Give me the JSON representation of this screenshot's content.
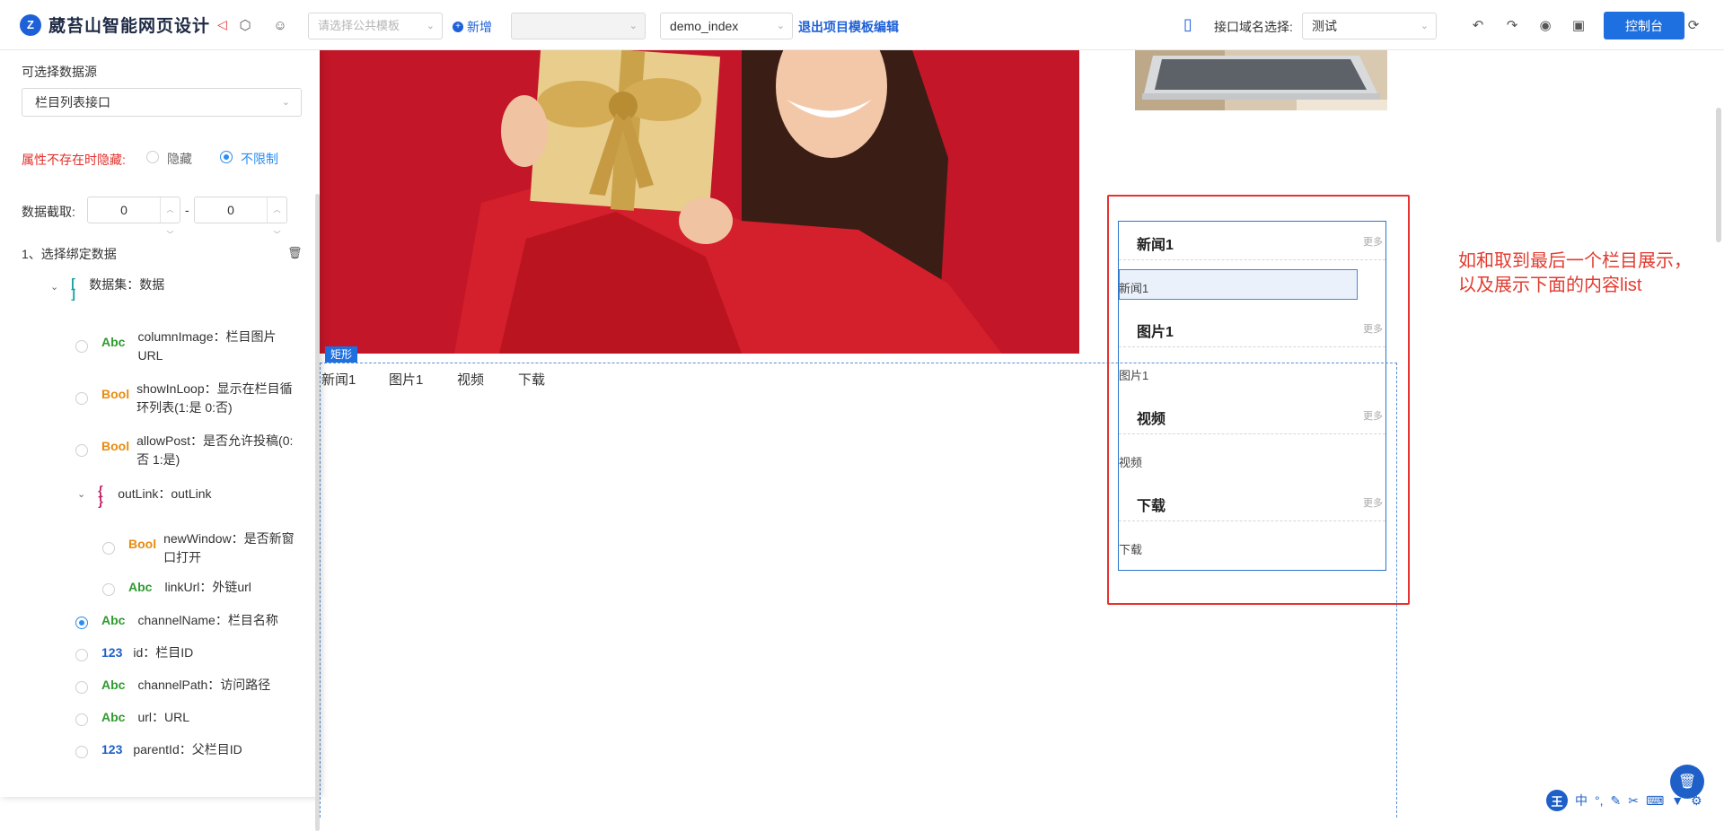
{
  "app": {
    "logo_mark": "Z",
    "title": "葳苔山智能网页设计"
  },
  "toolbar": {
    "template_placeholder": "请选择公共模板",
    "add_label": "新增",
    "page_select": "demo_index",
    "exit_link": "退出项目模板编辑",
    "domain_label": "接口域名选择:",
    "domain_value": "测试",
    "console_button": "控制台"
  },
  "left_panel": {
    "datasource_label": "可选择数据源",
    "datasource_value": "栏目列表接口",
    "hide_label": "属性不存在时隐藏:",
    "hide_option": "隐藏",
    "nolimit_option": "不限制",
    "slice_label": "数据截取:",
    "slice_from": "0",
    "slice_dash": "-",
    "slice_to": "0",
    "bind_title": "1、选择绑定数据",
    "dataset_label": "数据集：数据",
    "fields": [
      {
        "type": "Abc",
        "text": "columnImage：栏目图片URL"
      },
      {
        "type": "Bool",
        "text": "showInLoop：显示在栏目循环列表(1:是 0:否)"
      },
      {
        "type": "Bool",
        "text": "allowPost：是否允许投稿(0:否 1:是)"
      },
      {
        "type": "{ }",
        "text": "outLink：outLink"
      },
      {
        "type": "Bool",
        "text": "newWindow：是否新窗口打开"
      },
      {
        "type": "Abc",
        "text": "linkUrl：外链url"
      },
      {
        "type": "Abc",
        "text": "channelName：栏目名称"
      },
      {
        "type": "123",
        "text": "id：栏目ID"
      },
      {
        "type": "Abc",
        "text": "channelPath：访问路径"
      },
      {
        "type": "Abc",
        "text": "url：URL"
      },
      {
        "type": "123",
        "text": "parentId：父栏目ID"
      }
    ]
  },
  "canvas": {
    "rect_label": "矩形",
    "tabs": [
      "新闻1",
      "图片1",
      "视频",
      "下载"
    ],
    "columns": [
      {
        "title": "新闻1",
        "more": "更多",
        "item": "新闻1"
      },
      {
        "title": "图片1",
        "more": "更多",
        "item": "图片1"
      },
      {
        "title": "视频",
        "more": "更多",
        "item": "视频"
      },
      {
        "title": "下载",
        "more": "更多",
        "item": "下载"
      }
    ],
    "annotation_line1": "如和取到最后一个栏目展示，",
    "annotation_line2": "以及展示下面的内容list"
  },
  "ime": {
    "badge": "王",
    "mode": "中"
  },
  "colors": {
    "primary": "#1e6fe0",
    "annotation_red": "#e23b2f",
    "hero_bg": "#c41a2a"
  }
}
